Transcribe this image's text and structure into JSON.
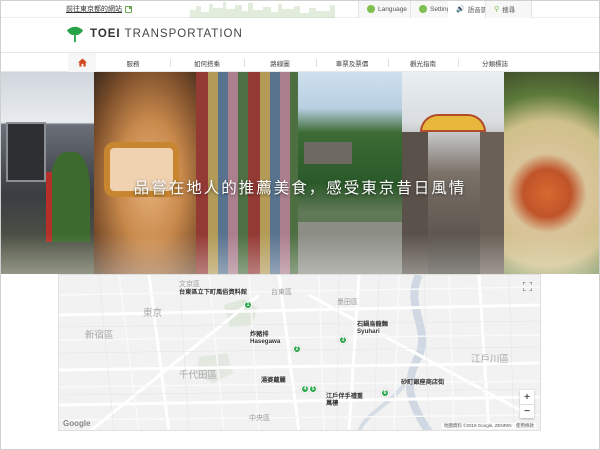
{
  "topbar": {
    "link_label": "前往東京都的網站",
    "language_label": "Language",
    "setting_label": "Setting",
    "read_aloud_label": "語音讀取",
    "search_label": "搜尋"
  },
  "header": {
    "brand_bold": "TOEI",
    "brand_rest": " TRANSPORTATION"
  },
  "nav": {
    "items": [
      "服務",
      "如何搭乘",
      "路線圖",
      "車票及票價",
      "觀光指南",
      "分類標誌"
    ]
  },
  "hero": {
    "caption": "品嘗在地人的推薦美食，感受東京昔日風情"
  },
  "map": {
    "districts": [
      "文京區",
      "台東區",
      "墨田區",
      "東京",
      "新宿區",
      "千代田區",
      "江戶川區",
      "中央區"
    ],
    "markers": [
      {
        "number": "1",
        "label": "台東區立下町風俗資料館"
      },
      {
        "number": "2",
        "label": "炸豬排\nHasegawa"
      },
      {
        "number": "3",
        "label": "石鍋烏龍麵\nSyuhari"
      },
      {
        "number": "4",
        "label": "湯婆蘿麗"
      },
      {
        "number": "5",
        "label": "江戶伴手禮重\n萬樓"
      },
      {
        "number": "6",
        "label": "砂町銀座商店街"
      }
    ],
    "zoom_in": "+",
    "zoom_out": "−",
    "google_label": "Google",
    "attribution": "地圖資料 ©2019 Google, ZENRIN　使用條款"
  },
  "colors": {
    "brand_green": "#27a449",
    "nav_active_bg": "#f6f6f6"
  }
}
